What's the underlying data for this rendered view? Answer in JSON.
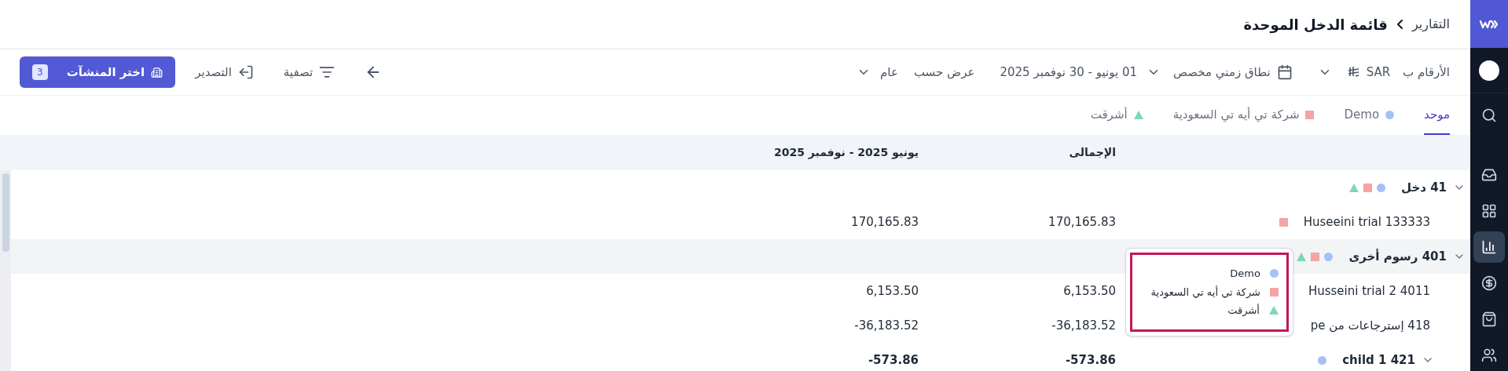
{
  "breadcrumb": {
    "parent": "التقارير",
    "current": "قائمة الدخل الموحدة"
  },
  "toolbar": {
    "numbers_label": "الأرقام ب",
    "currency": "SAR",
    "date_range_type": "نطاق زمني مخصص",
    "date_range": "01 يونيو - 30 نوفمبر 2025",
    "view_by_label": "عرض حسب",
    "view_by": "عام",
    "filter": "تصفية",
    "export": "التصدير",
    "select_entities": {
      "label": "اختر المنشآت",
      "count": "3"
    }
  },
  "tabs": [
    {
      "label": "موحد",
      "selected": true
    },
    {
      "label": "Demo",
      "selected": false,
      "kind": "circle",
      "color": "#a4c1f7"
    },
    {
      "label": "شركة تي أيه تي السعودية",
      "selected": false,
      "kind": "square",
      "color": "#f4a4a4"
    },
    {
      "label": "أشرقت",
      "selected": false,
      "kind": "triangle",
      "color": "#7fd8b4"
    }
  ],
  "table": {
    "columns": [
      "الإجمالى",
      "يونيو 2025 - نوفمبر 2025"
    ],
    "rows": [
      {
        "kind": "group",
        "label": "41 دخل",
        "expanded": true,
        "highlighted": false,
        "markers": [
          {
            "kind": "circle",
            "color": "#a4c1f7"
          },
          {
            "kind": "square",
            "color": "#f4a4a4"
          },
          {
            "kind": "triangle",
            "color": "#7fd8b4"
          }
        ],
        "values": []
      },
      {
        "kind": "account",
        "label": "Huseeini trial 133333",
        "highlighted": false,
        "markers": [
          {
            "kind": "square",
            "color": "#f4a4a4"
          }
        ],
        "values": [
          "170,165.83",
          "170,165.83"
        ]
      },
      {
        "kind": "group",
        "label": "401 رسوم أخرى",
        "expanded": true,
        "highlighted": true,
        "markers": [
          {
            "kind": "circle",
            "color": "#a4c1f7"
          },
          {
            "kind": "square",
            "color": "#f4a4a4"
          },
          {
            "kind": "triangle",
            "color": "#7fd8b4"
          }
        ],
        "values": []
      },
      {
        "kind": "account",
        "label": "Husseini trial 2 4011",
        "highlighted": false,
        "markers": [],
        "values": [
          "6,153.50",
          "6,153.50"
        ]
      },
      {
        "kind": "account",
        "label": "418 إسترجاعات من pe",
        "highlighted": false,
        "markers": [],
        "values": [
          "-36,183.52",
          "-36,183.52"
        ]
      },
      {
        "kind": "subgroup",
        "label": "421 child 1",
        "expanded": true,
        "highlighted": false,
        "markers": [
          {
            "kind": "circle",
            "color": "#a4c1f7"
          }
        ],
        "values": [
          "-573.86",
          "-573.86"
        ]
      }
    ]
  },
  "tooltip": {
    "items": [
      {
        "label": "Demo",
        "kind": "circle",
        "color": "#a4c1f7"
      },
      {
        "label": "شركة تي أيه تي السعودية",
        "kind": "square",
        "color": "#f4a4a4"
      },
      {
        "label": "أشرقت",
        "kind": "triangle",
        "color": "#7fd8b4"
      }
    ]
  }
}
